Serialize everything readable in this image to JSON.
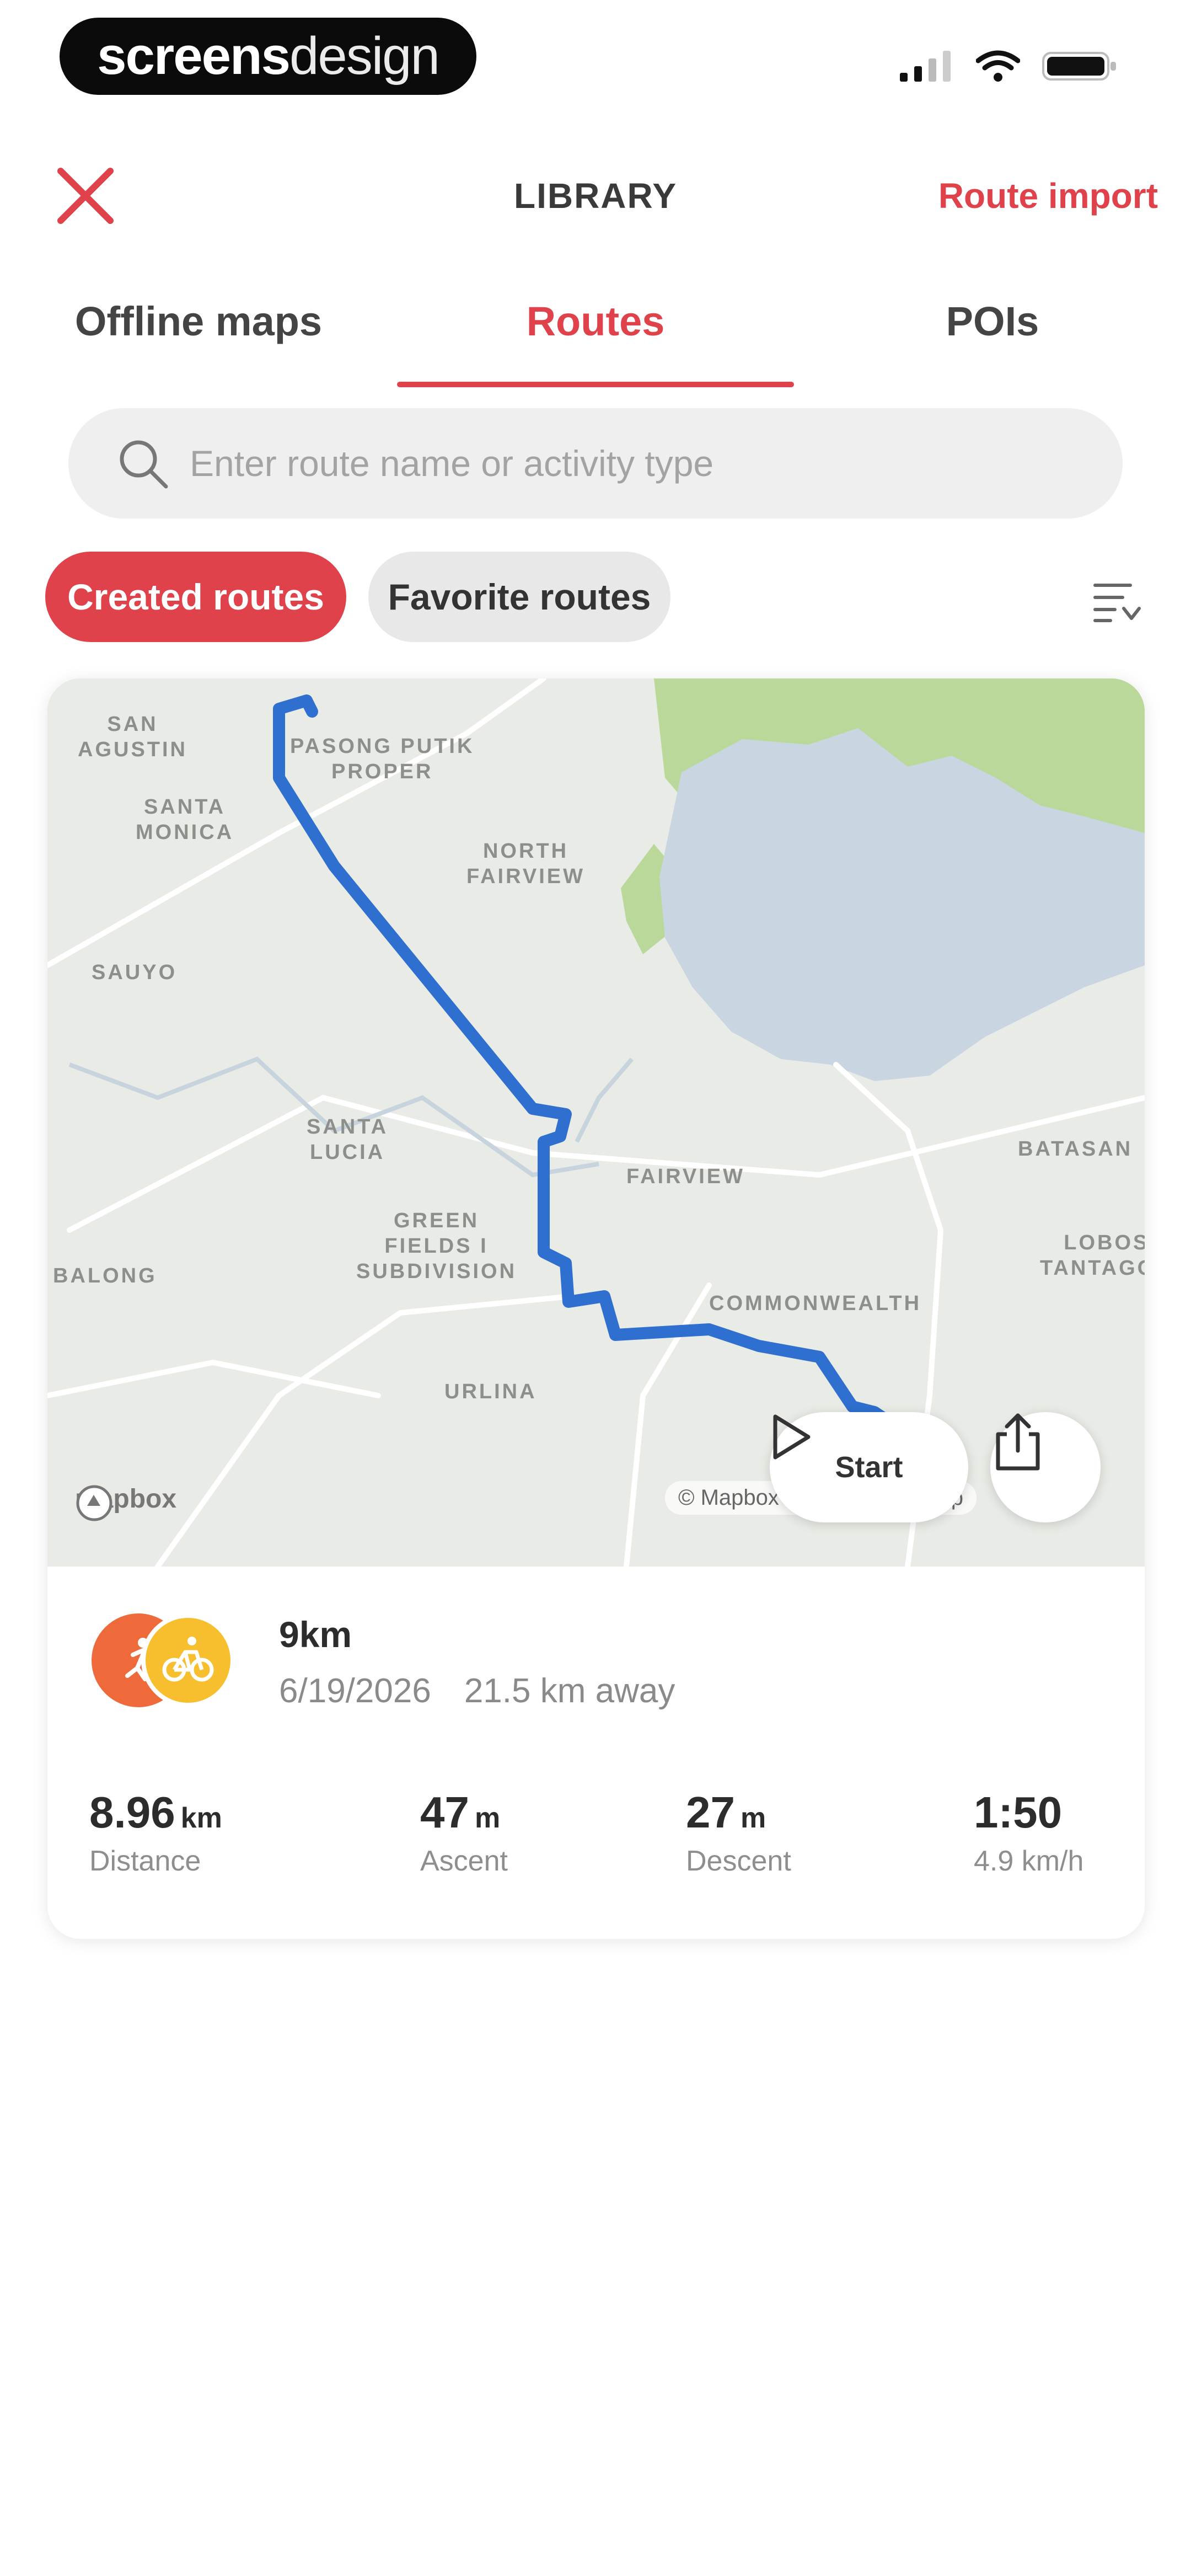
{
  "status_bar": {
    "brand_bold": "screens",
    "brand_light": "design"
  },
  "header": {
    "title": "LIBRARY",
    "action": "Route import"
  },
  "tabs": [
    {
      "label": "Offline maps",
      "active": false
    },
    {
      "label": "Routes",
      "active": true
    },
    {
      "label": "POIs",
      "active": false
    }
  ],
  "search": {
    "placeholder": "Enter route name or activity type"
  },
  "chips": {
    "created": "Created routes",
    "favorite": "Favorite routes"
  },
  "map": {
    "labels": [
      {
        "text": "SAN\nAGUSTIN"
      },
      {
        "text": "PASONG PUTIK\nPROPER"
      },
      {
        "text": "SANTA\nMONICA"
      },
      {
        "text": "NORTH\nFAIRVIEW"
      },
      {
        "text": "SAUYO"
      },
      {
        "text": "SANTA\nLUCIA"
      },
      {
        "text": "FAIRVIEW"
      },
      {
        "text": "GREEN\nFIELDS I\nSUBDIVISION"
      },
      {
        "text": "COMMONWEALTH"
      },
      {
        "text": "URLINA"
      },
      {
        "text": "BATASAN"
      },
      {
        "text": "LOBOS\nTANTAGON"
      },
      {
        "text": "BALONG"
      }
    ],
    "attribution": "© Mapbox © OpenStreetMap",
    "logo": "mapbox",
    "route_color": "#2f6fd0",
    "water_color": "#c9d6e2",
    "park_color": "#b9d89a"
  },
  "actions": {
    "start": "Start"
  },
  "route": {
    "name": "9km",
    "date": "6/19/2026",
    "distance_away": "21.5 km away",
    "activities": [
      "running-icon",
      "cycling-icon"
    ]
  },
  "stats": [
    {
      "value": "8.96",
      "unit": "km",
      "label": "Distance"
    },
    {
      "value": "47",
      "unit": "m",
      "label": "Ascent"
    },
    {
      "value": "27",
      "unit": "m",
      "label": "Descent"
    },
    {
      "value": "1:50",
      "unit": "",
      "label": "4.9 km/h"
    }
  ],
  "colors": {
    "accent": "#e0424b",
    "chip_inactive": "#e8e8e8"
  }
}
